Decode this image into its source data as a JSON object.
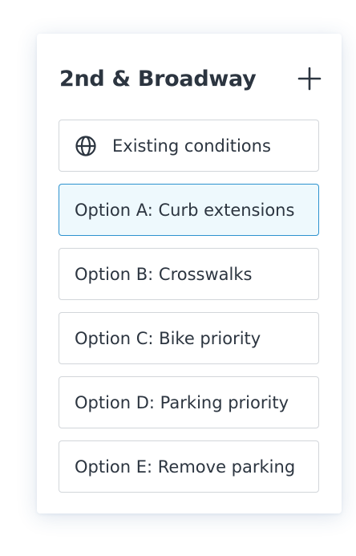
{
  "panel": {
    "title": "2nd & Broadway",
    "add_icon": "plus-icon"
  },
  "options": [
    {
      "label": "Existing conditions",
      "icon": "globe-icon",
      "selected": false
    },
    {
      "label": "Option A: Curb extensions",
      "selected": true
    },
    {
      "label": "Option B: Crosswalks",
      "selected": false
    },
    {
      "label": "Option C: Bike priority",
      "selected": false
    },
    {
      "label": "Option D: Parking priority",
      "selected": false
    },
    {
      "label": "Option E: Remove parking",
      "selected": false
    }
  ],
  "colors": {
    "selected_border": "#2e93cf",
    "selected_background": "#eef9fd",
    "default_border": "#d2d6da",
    "text": "#2c3540"
  }
}
